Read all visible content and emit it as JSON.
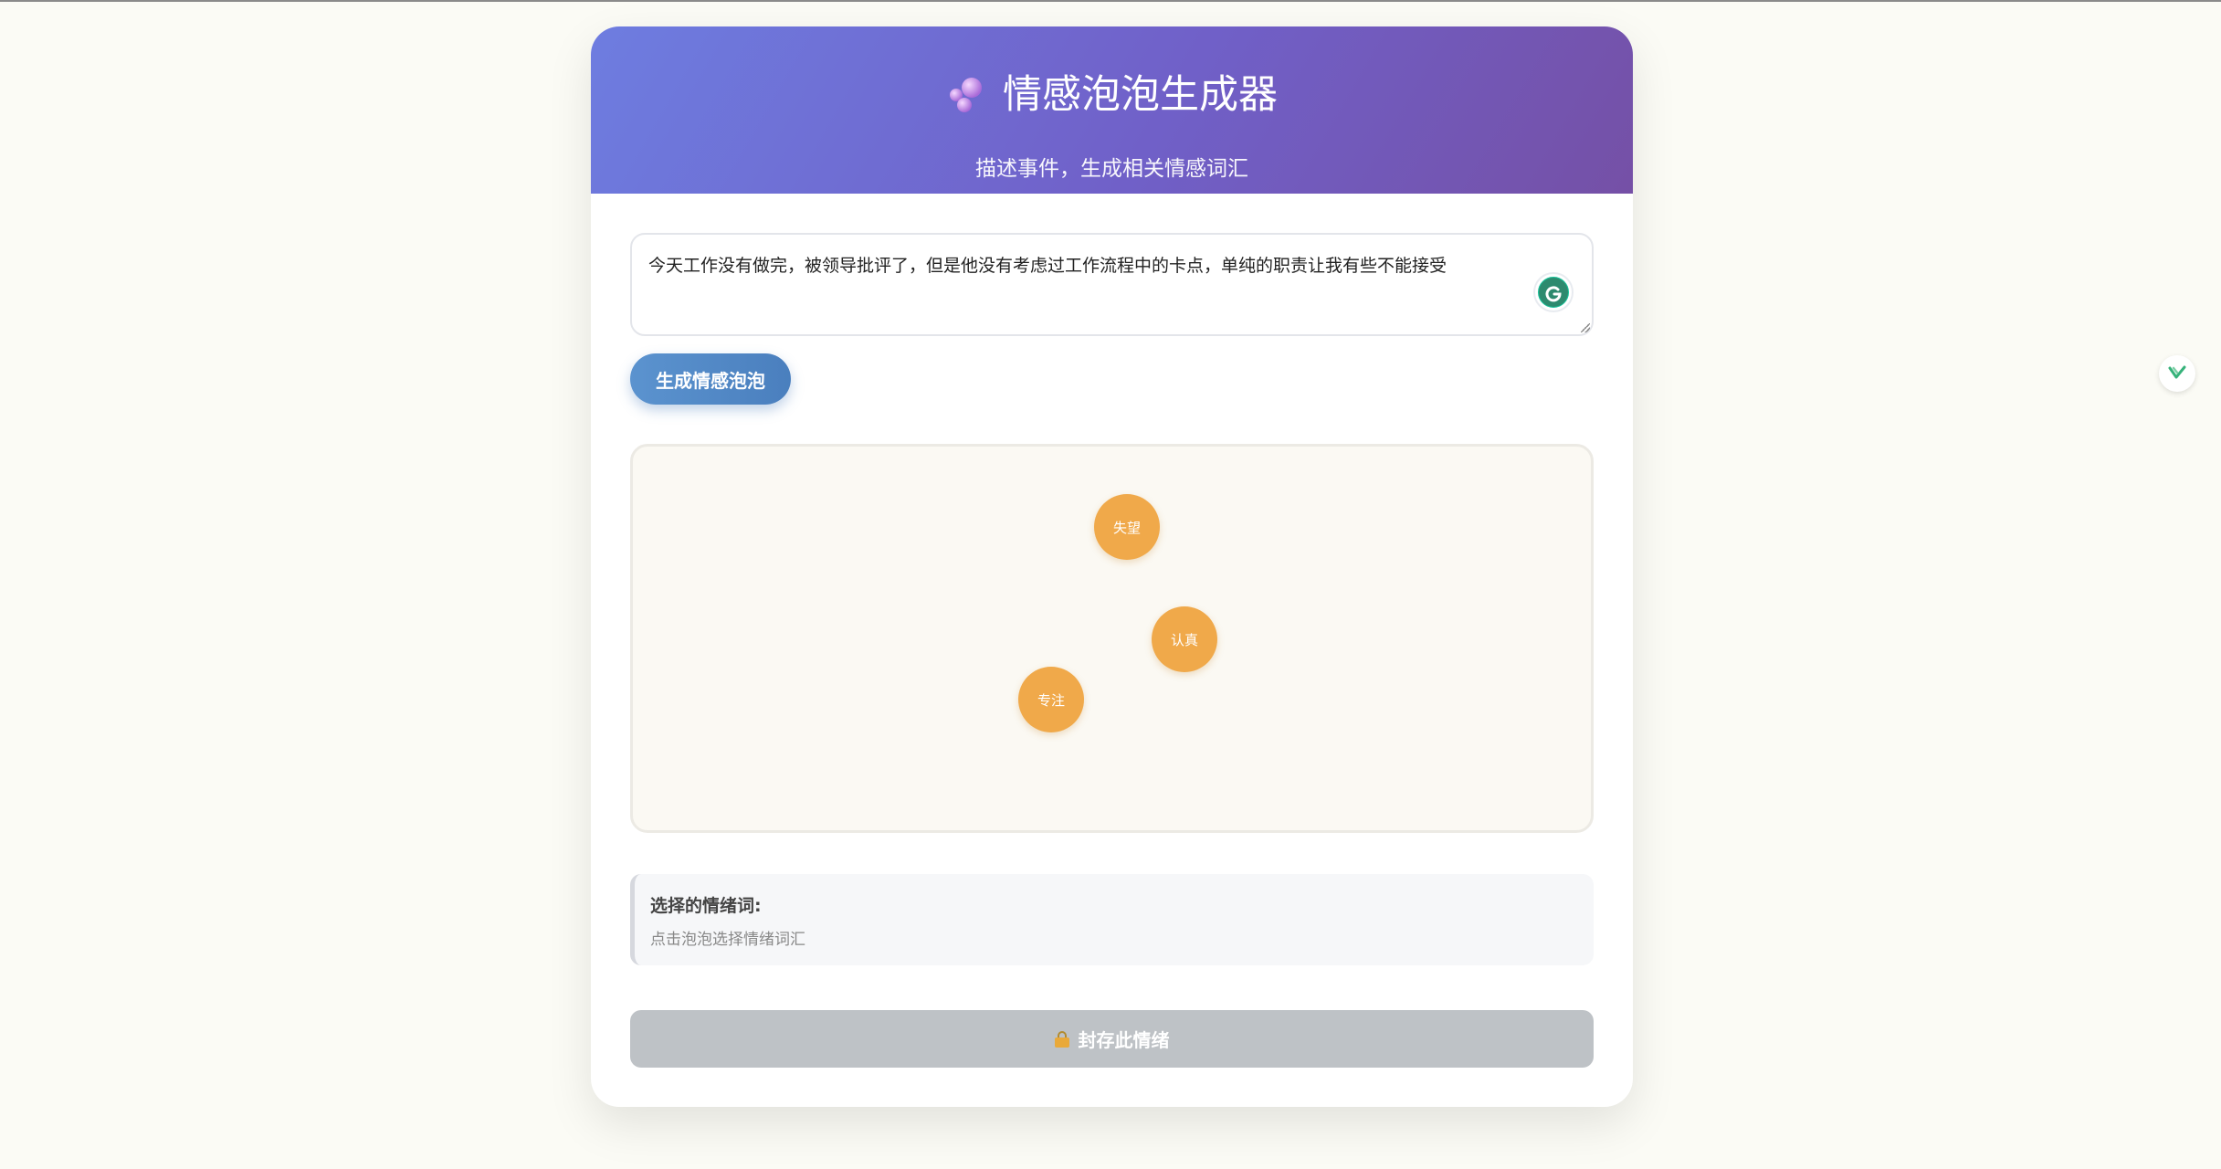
{
  "header": {
    "title": "情感泡泡生成器",
    "subtitle": "描述事件，生成相关情感词汇"
  },
  "input": {
    "value": "今天工作没有做完，被领导批评了，但是他没有考虑过工作流程中的卡点，单纯的职责让我有些不能接受"
  },
  "generate_button": {
    "label": "生成情感泡泡"
  },
  "bubbles": [
    {
      "label": "失望"
    },
    {
      "label": "认真"
    },
    {
      "label": "专注"
    }
  ],
  "selected": {
    "label": "选择的情绪词:",
    "hint": "点击泡泡选择情绪词汇"
  },
  "seal_button": {
    "label": "封存此情绪"
  },
  "colors": {
    "header_gradient_start": "#6e7de0",
    "header_gradient_end": "#7550a6",
    "bubble": "#f0a94a",
    "generate_button": "#4a7fbe",
    "seal_button_disabled": "#bec2c6"
  },
  "icons": [
    "bubbles-icon",
    "grammarly-icon",
    "lock-icon",
    "extension-icon"
  ]
}
